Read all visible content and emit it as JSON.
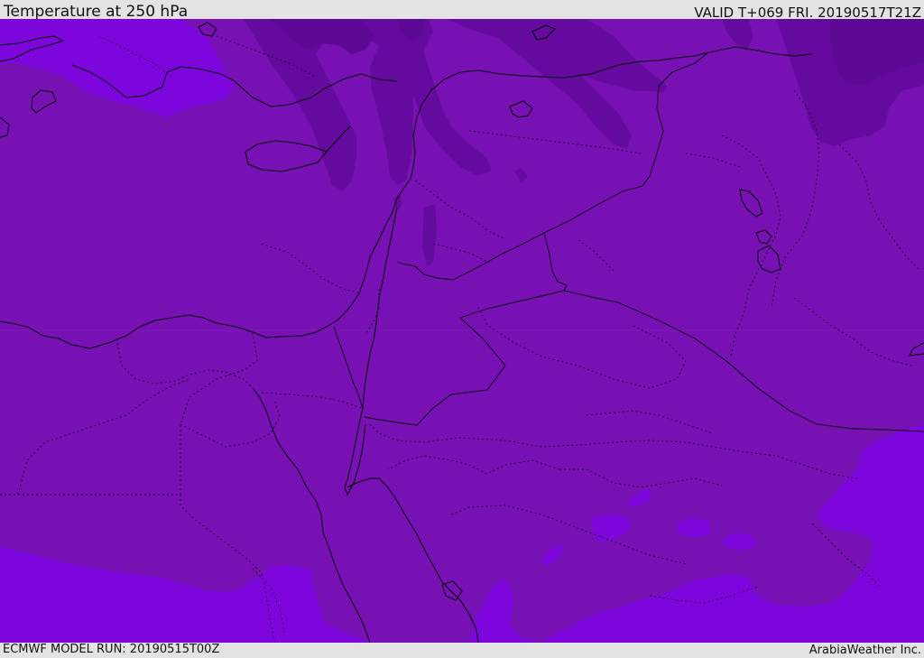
{
  "header": {
    "title": "Temperature at 250 hPa",
    "valid_time": "VALID T+069 FRI. 20190517T21Z"
  },
  "footer": {
    "model_run": "ECMWF MODEL RUN: 20190515T00Z",
    "credit": "ArabiaWeather Inc."
  },
  "map": {
    "field": "temperature-250hPa",
    "colors": {
      "base": "#7711b3",
      "cold": "#650a9e",
      "colder": "#5e0896",
      "warm": "#7d06dd",
      "coastline": "#000000",
      "border": "#1a0030"
    }
  }
}
